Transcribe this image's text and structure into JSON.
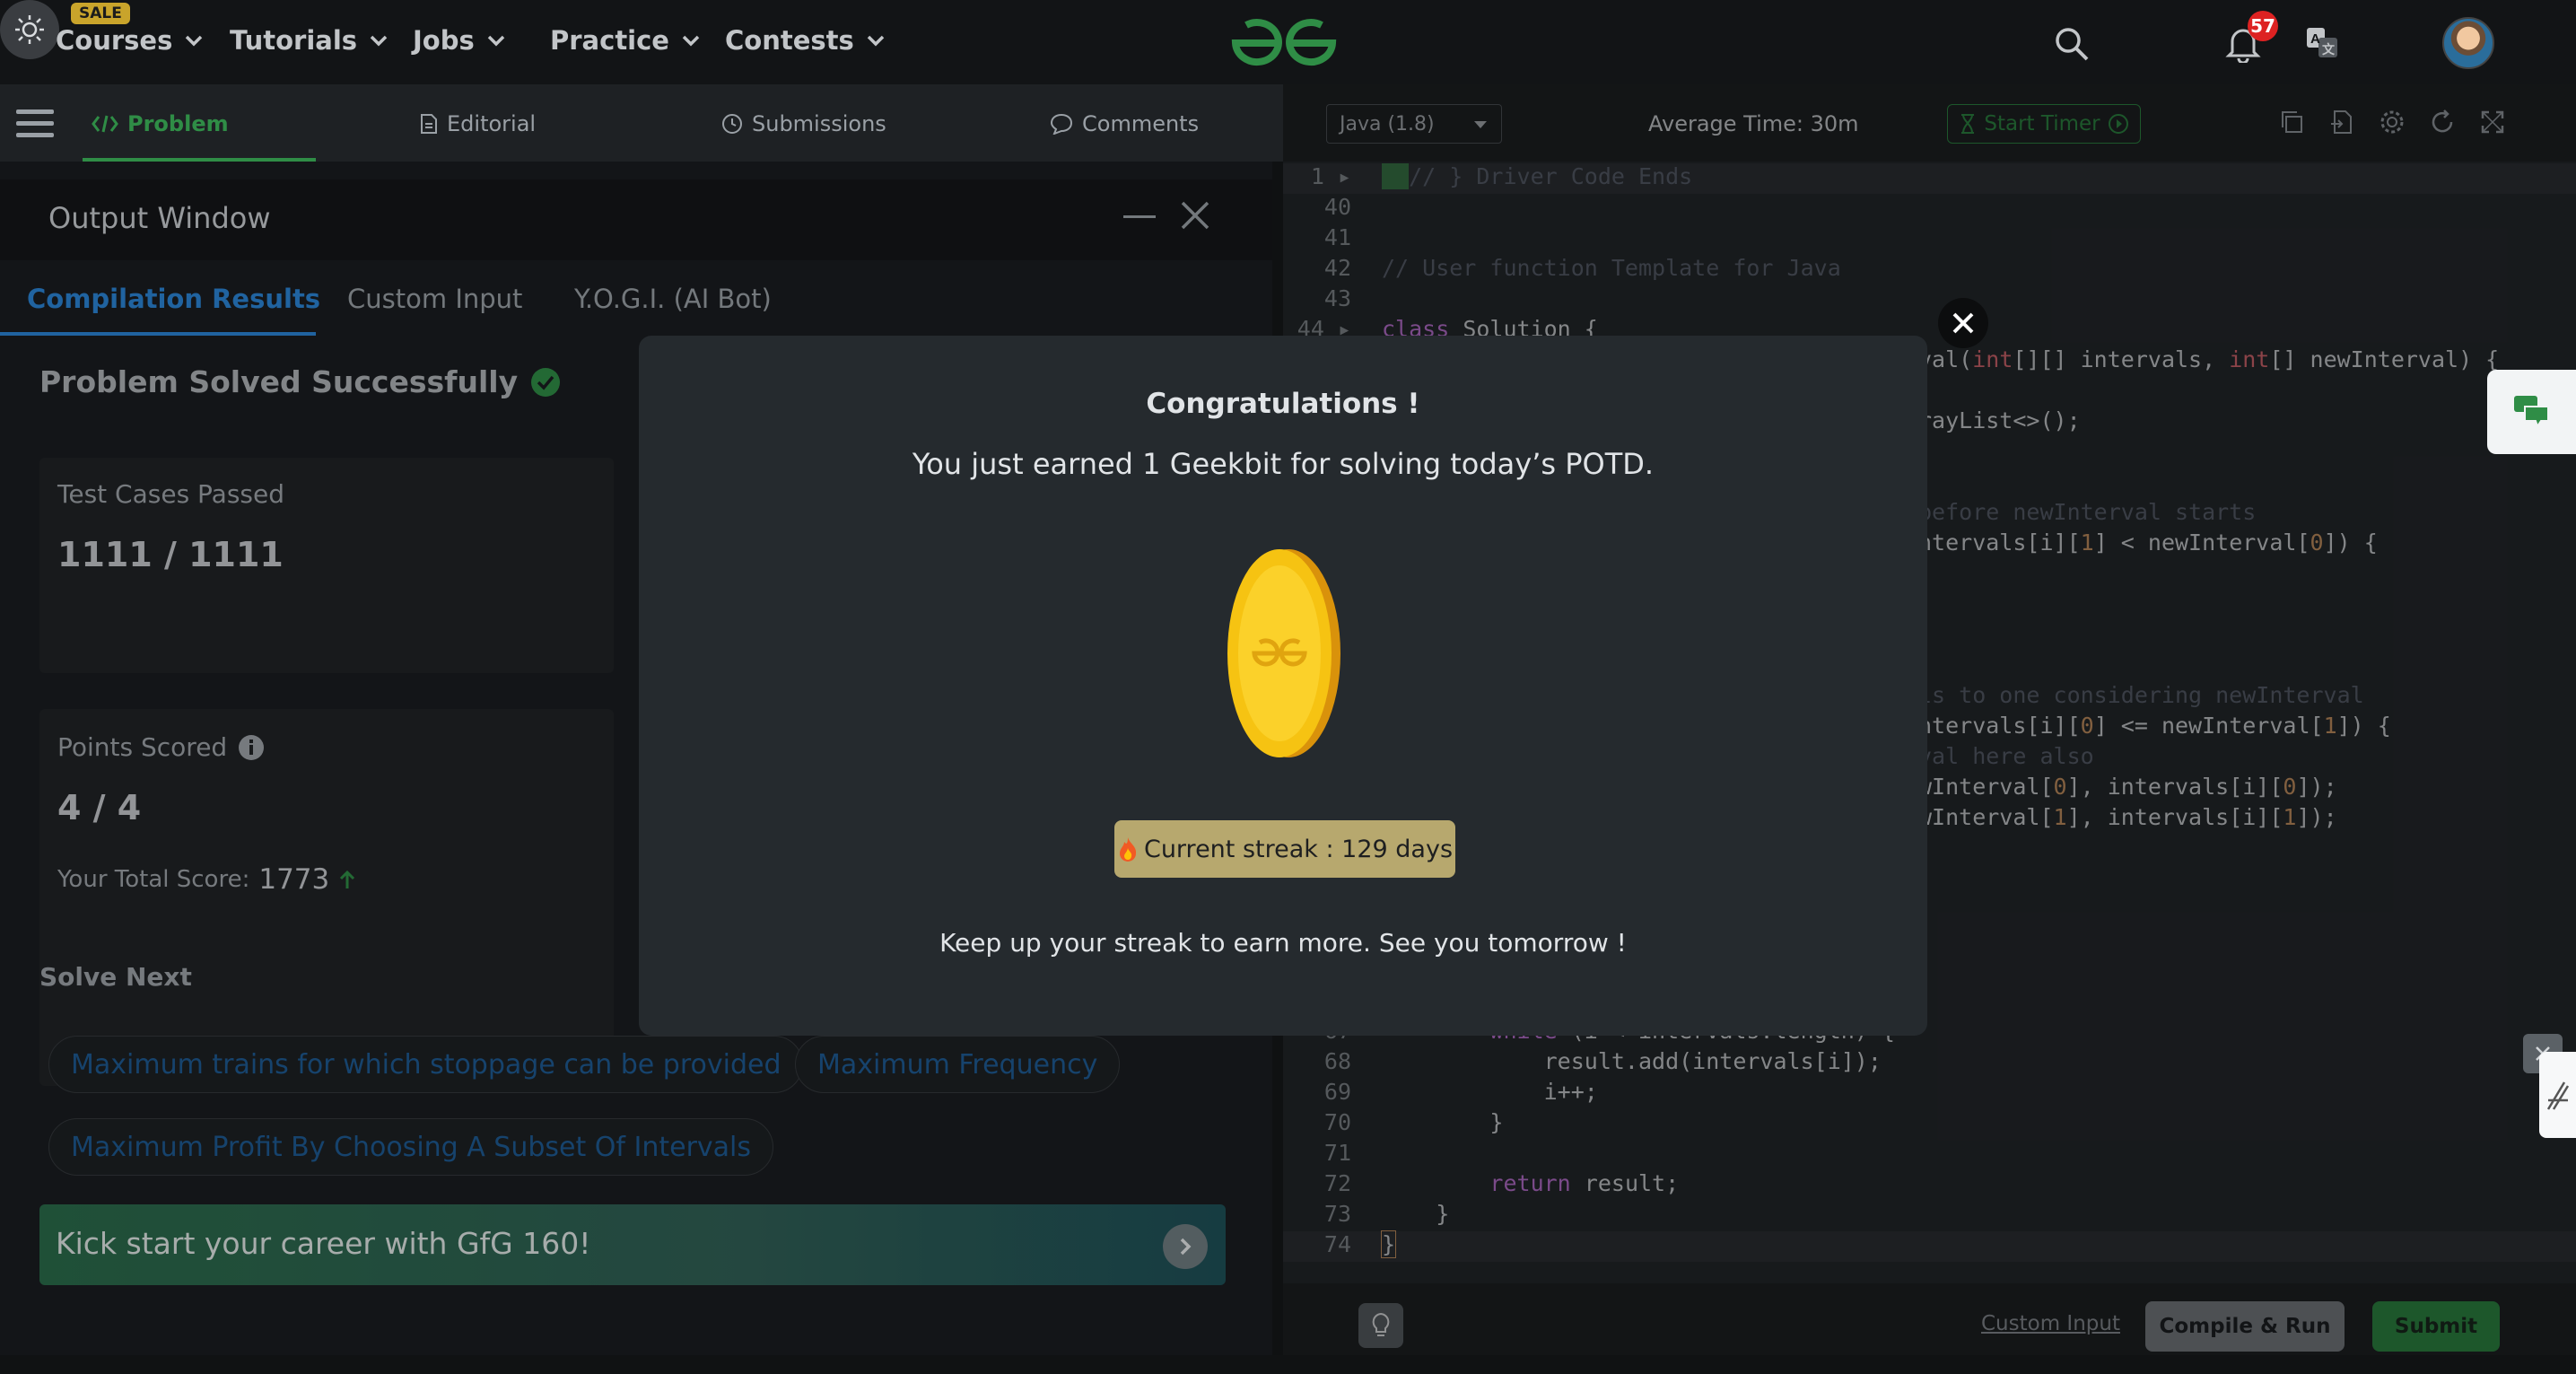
{
  "nav": {
    "sale_badge": "SALE",
    "items": [
      {
        "label": "Courses"
      },
      {
        "label": "Tutorials"
      },
      {
        "label": "Jobs"
      },
      {
        "label": "Practice"
      },
      {
        "label": "Contests"
      }
    ],
    "notification_count": "57",
    "icons": [
      "search-icon",
      "sun-icon",
      "bell-icon",
      "translate-icon",
      "avatar"
    ]
  },
  "left_tabs": [
    "Problem",
    "Editorial",
    "Submissions",
    "Comments"
  ],
  "output_window": {
    "title": "Output Window",
    "tabs": [
      "Compilation Results",
      "Custom Input",
      "Y.O.G.I. (AI Bot)"
    ],
    "status": "Problem Solved Successfully",
    "test_cases_label": "Test Cases Passed",
    "test_cases_value": "1111 / 1111",
    "points_label": "Points Scored",
    "points_value": "4 / 4",
    "total_score_label": "Your Total Score:",
    "total_score_value": "1773",
    "solve_next_label": "Solve Next",
    "solve_next": [
      "Maximum trains for which stoppage can be provided",
      "Maximum Frequency",
      "Maximum Profit By Choosing A Subset Of Intervals"
    ],
    "banner_text": "Kick start your career with GfG 160!"
  },
  "editor": {
    "language": "Java (1.8)",
    "average_time": "Average Time: 30m",
    "start_timer": "Start Timer",
    "custom_input": "Custom Input",
    "compile_run": "Compile & Run",
    "submit": "Submit"
  },
  "modal": {
    "title": "Congratulations !",
    "message": "You just earned 1 Geekbit for solving today’s POTD.",
    "streak": "Current streak : 129 days",
    "footer": "Keep up your streak to earn more. See you tomorrow !"
  },
  "colors": {
    "gfg_green": "#2f8d46",
    "link_blue": "#2b84d6",
    "badge_red": "#dd2222",
    "coin_gold": "#f5c518",
    "streak_bg": "#b7a86e"
  }
}
